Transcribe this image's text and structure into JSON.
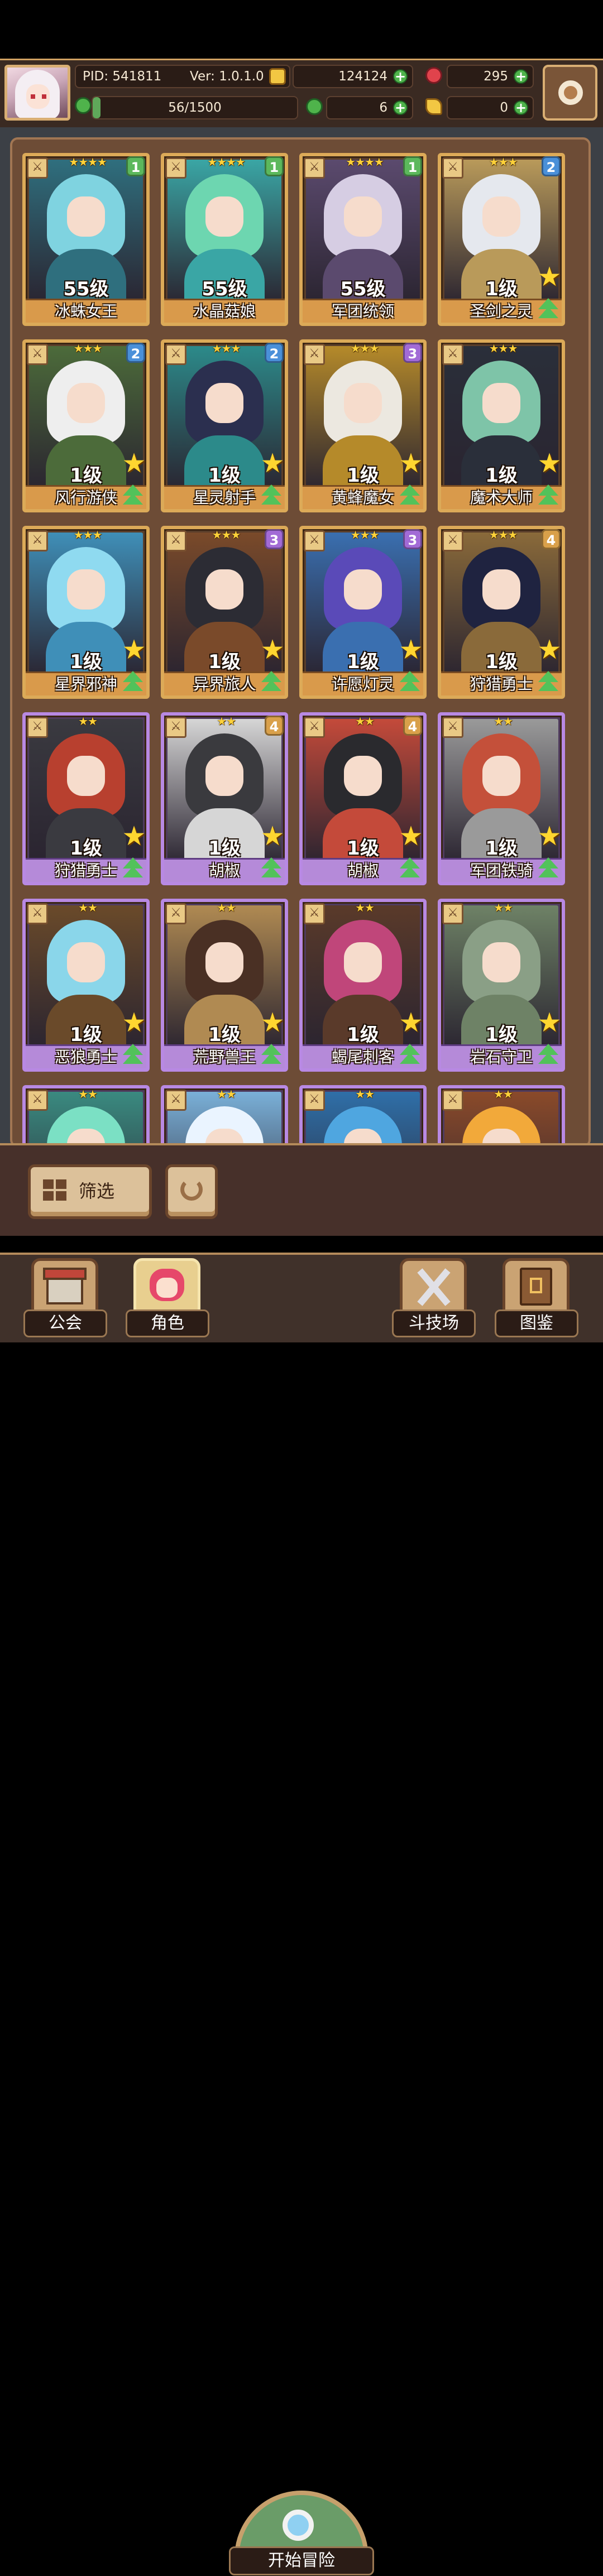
{
  "header": {
    "pid": "PID: 541811",
    "version": "Ver: 1.0.1.0",
    "gold": "124124",
    "gems": "295",
    "clover_progress": "56/1500",
    "clover_fraction": 0.037,
    "clovers": "6",
    "keys": "0"
  },
  "cards": [
    {
      "name": "冰蛛女王",
      "level": "55级",
      "stars": "★★★★",
      "rank": "1",
      "tier": "gold",
      "hair": "#7fd3e0",
      "body": "#2f6f7e",
      "upgrade": false
    },
    {
      "name": "水晶菇娘",
      "level": "55级",
      "stars": "★★★★",
      "rank": "1",
      "tier": "gold",
      "hair": "#6dd6b0",
      "body": "#3aa6a5",
      "upgrade": false
    },
    {
      "name": "军团统领",
      "level": "55级",
      "stars": "★★★★",
      "rank": "1",
      "tier": "gold",
      "hair": "#d6cde3",
      "body": "#5b4a6e",
      "upgrade": false
    },
    {
      "name": "圣剑之灵",
      "level": "1级",
      "stars": "★★★",
      "rank": "2",
      "tier": "gold",
      "hair": "#e5e8ee",
      "body": "#b99a5a",
      "upgrade": true
    },
    {
      "name": "风行游侠",
      "level": "1级",
      "stars": "★★★",
      "rank": "2",
      "tier": "gold",
      "hair": "#eeeeee",
      "body": "#4c6b3a",
      "upgrade": true
    },
    {
      "name": "星灵射手",
      "level": "1级",
      "stars": "★★★",
      "rank": "2",
      "tier": "gold",
      "hair": "#2b2f4f",
      "body": "#2c8a8a",
      "upgrade": true
    },
    {
      "name": "黄蜂魔女",
      "level": "1级",
      "stars": "★★★",
      "rank": "3",
      "tier": "gold",
      "hair": "#ece8e0",
      "body": "#b58a2a",
      "upgrade": true
    },
    {
      "name": "魔术大师",
      "level": "1级",
      "stars": "★★★",
      "rank": "",
      "tier": "gold",
      "hair": "#7ec4a8",
      "body": "#2a2f3a",
      "upgrade": true
    },
    {
      "name": "星界邪神",
      "level": "1级",
      "stars": "★★★",
      "rank": "",
      "tier": "gold",
      "hair": "#8fdaf0",
      "body": "#3f8fb8",
      "upgrade": true
    },
    {
      "name": "异界旅人",
      "level": "1级",
      "stars": "★★★",
      "rank": "3",
      "tier": "gold",
      "hair": "#2c2c34",
      "body": "#7a4a2a",
      "upgrade": true
    },
    {
      "name": "许愿灯灵",
      "level": "1级",
      "stars": "★★★",
      "rank": "3",
      "tier": "gold",
      "hair": "#5a4ab8",
      "body": "#3a6fb0",
      "upgrade": true
    },
    {
      "name": "狩猎勇士",
      "level": "1级",
      "stars": "★★★",
      "rank": "4",
      "tier": "gold",
      "hair": "#1f2340",
      "body": "#8a6a3a",
      "upgrade": true
    },
    {
      "name": "狩猎勇士",
      "level": "1级",
      "stars": "★★",
      "rank": "",
      "tier": "purple",
      "hair": "#b8402f",
      "body": "#3a3a40",
      "upgrade": true
    },
    {
      "name": "胡椒",
      "level": "1级",
      "stars": "★★",
      "rank": "4",
      "tier": "purple",
      "hair": "#3a3a3e",
      "body": "#d6d6d6",
      "upgrade": true
    },
    {
      "name": "胡椒",
      "level": "1级",
      "stars": "★★",
      "rank": "4",
      "tier": "purple",
      "hair": "#2a2a2e",
      "body": "#c44a3a",
      "upgrade": true
    },
    {
      "name": "军团铁骑",
      "level": "1级",
      "stars": "★★",
      "rank": "",
      "tier": "purple",
      "hair": "#c4503a",
      "body": "#9a9a9a",
      "upgrade": true
    },
    {
      "name": "恶狼勇士",
      "level": "1级",
      "stars": "★★",
      "rank": "",
      "tier": "purple",
      "hair": "#8ad6ea",
      "body": "#6a4a2a",
      "upgrade": true
    },
    {
      "name": "荒野兽王",
      "level": "1级",
      "stars": "★★",
      "rank": "",
      "tier": "purple",
      "hair": "#4a3024",
      "body": "#b08a52",
      "upgrade": true
    },
    {
      "name": "蝎尾刺客",
      "level": "1级",
      "stars": "★★",
      "rank": "",
      "tier": "purple",
      "hair": "#c0467a",
      "body": "#5a3a2a",
      "upgrade": true
    },
    {
      "name": "岩石守卫",
      "level": "1级",
      "stars": "★★",
      "rank": "",
      "tier": "purple",
      "hair": "#8a9f86",
      "body": "#6e8266",
      "upgrade": true
    },
    {
      "name": "",
      "level": "",
      "stars": "★★",
      "rank": "",
      "tier": "purple",
      "hair": "#7be0c4",
      "body": "#3a8a80",
      "upgrade": false
    },
    {
      "name": "",
      "level": "",
      "stars": "★★",
      "rank": "",
      "tier": "purple",
      "hair": "#eaf4ff",
      "body": "#7ab0d8",
      "upgrade": false
    },
    {
      "name": "",
      "level": "",
      "stars": "★★",
      "rank": "",
      "tier": "purple",
      "hair": "#4fa6e0",
      "body": "#2f6fa8",
      "upgrade": false
    },
    {
      "name": "",
      "level": "",
      "stars": "★★",
      "rank": "",
      "tier": "purple",
      "hair": "#f2a93a",
      "body": "#8a4a2a",
      "upgrade": false
    }
  ],
  "rank_colors": {
    "1": "#5cb85c",
    "2": "#4a90d9",
    "3": "#a26bd6",
    "4": "#d9a04a"
  },
  "controls": {
    "filter_label": "筛选"
  },
  "nav": {
    "guild": "公会",
    "role": "角色",
    "adventure": "开始冒险",
    "arena": "斗技场",
    "codex": "图鉴"
  }
}
